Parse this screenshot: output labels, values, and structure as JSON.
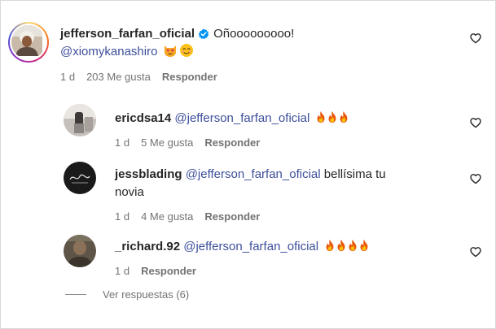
{
  "comments": [
    {
      "username": "jefferson_farfan_oficial",
      "verified": true,
      "text": "Oñooooooooo!",
      "mention": "@xiomykanashiro",
      "emojis": [
        "heart-eyes-cat",
        "smiling-face"
      ],
      "time": "1 d",
      "likes": "203 Me gusta",
      "reply": "Responder"
    },
    {
      "username": "ericdsa14",
      "mention": "@jefferson_farfan_oficial",
      "emojis": [
        "fire",
        "fire",
        "fire"
      ],
      "time": "1 d",
      "likes": "5 Me gusta",
      "reply": "Responder"
    },
    {
      "username": "jessblading",
      "mention": "@jefferson_farfan_oficial",
      "text_line1": "bellísima tu",
      "text_line2": "novia",
      "time": "1 d",
      "likes": "4 Me gusta",
      "reply": "Responder"
    },
    {
      "username": "_richard.92",
      "mention": "@jefferson_farfan_oficial",
      "emojis": [
        "fire",
        "fire",
        "fire",
        "fire"
      ],
      "time": "1 d",
      "reply": "Responder"
    }
  ],
  "view_replies": "Ver respuestas (6)",
  "colors": {
    "mention": "#3d4f9b",
    "verified": "#0095f6",
    "meta": "#737373"
  }
}
